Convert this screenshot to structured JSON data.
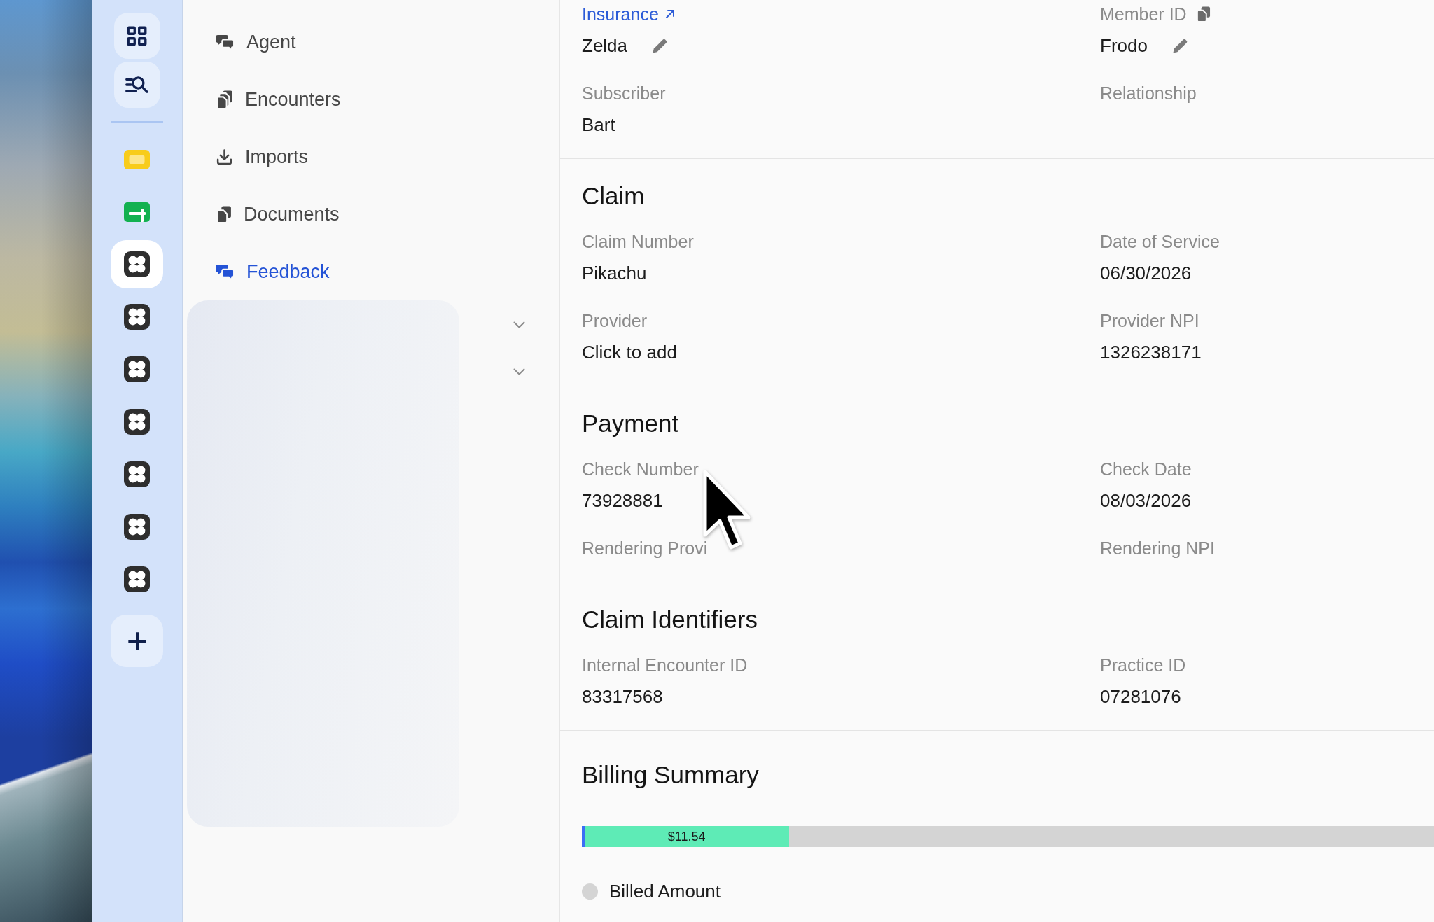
{
  "dock": {
    "apps": [
      {
        "kind": "frame",
        "selected": false
      },
      {
        "kind": "addbar",
        "selected": false
      },
      {
        "kind": "clover",
        "selected": true
      },
      {
        "kind": "clover",
        "selected": false
      },
      {
        "kind": "clover",
        "selected": false
      },
      {
        "kind": "clover",
        "selected": false
      },
      {
        "kind": "clover",
        "selected": false
      },
      {
        "kind": "clover",
        "selected": false
      },
      {
        "kind": "clover",
        "selected": false
      }
    ]
  },
  "sidebar": {
    "nav": [
      {
        "label": "Agent",
        "kind": "chat",
        "selected": false
      },
      {
        "label": "Encounters",
        "kind": "files",
        "selected": false
      },
      {
        "label": "Imports",
        "kind": "download",
        "selected": false
      },
      {
        "label": "Documents",
        "kind": "pages",
        "selected": false
      },
      {
        "label": "Feedback",
        "kind": "chat",
        "selected": true
      }
    ],
    "toggles": [
      {
        "expanded": false
      },
      {
        "expanded": false
      }
    ]
  },
  "detail": {
    "sections": [
      {
        "fields": [
          {
            "label": "Insurance",
            "kind": "link",
            "value": "Zelda",
            "editable": true
          },
          {
            "label": "Member ID",
            "kind": "copy",
            "value": "Frodo",
            "editable": true
          },
          {
            "label": "Subscriber",
            "kind": "plain",
            "value": "Bart",
            "editable": false
          },
          {
            "label": "Relationship",
            "kind": "plain",
            "editable": false
          }
        ]
      },
      {
        "title": "Claim",
        "fields": [
          {
            "label": "Claim Number",
            "value": "Pikachu"
          },
          {
            "label": "Date of Service",
            "value": "06/30/2026"
          },
          {
            "label": "Provider",
            "value": "Click to add"
          },
          {
            "label": "Provider NPI",
            "value": "1326238171"
          }
        ]
      },
      {
        "title": "Payment",
        "fields": [
          {
            "label": "Check Number",
            "value": "73928881"
          },
          {
            "label": "Check Date",
            "value": "08/03/2026"
          },
          {
            "label": "Rendering Provi"
          },
          {
            "label": "Rendering NPI"
          }
        ]
      },
      {
        "title": "Claim Identifiers",
        "fields": [
          {
            "label": "Internal Encounter ID",
            "value": "83317568"
          },
          {
            "label": "Practice ID",
            "value": "07281076"
          }
        ]
      }
    ],
    "billing_summary": {
      "title": "Billing Summary",
      "bar": {
        "segments": [
          {
            "color": "#3b6ef5",
            "level": 0.003
          },
          {
            "label": "$11.54",
            "color": "#5eebb6",
            "level": 0.24
          }
        ]
      },
      "legend": [
        {
          "label": "Billed Amount",
          "color": "#d4d4d4"
        }
      ]
    }
  }
}
